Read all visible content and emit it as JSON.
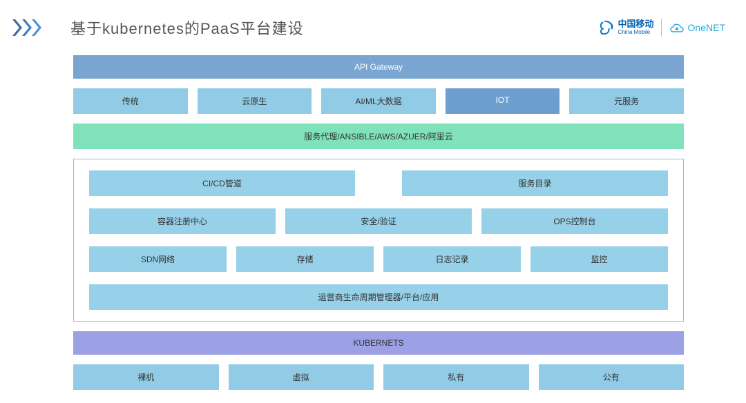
{
  "header": {
    "title": "基于kubernetes的PaaS平台建设",
    "logo1_main": "中国移动",
    "logo1_sub": "China Mobile",
    "logo2": "OneNET"
  },
  "rows": {
    "api": "API Gateway",
    "cats": [
      "传统",
      "云原生",
      "AI/ML大数据",
      "IOT",
      "元服务"
    ],
    "proxy": "服务代理/ANSIBLE/AWS/AZUER/阿里云",
    "mid_r1": [
      "CI/CD管道",
      "服务目录"
    ],
    "mid_r2": [
      "容器注册中心",
      "安全/验证",
      "OPS控制台"
    ],
    "mid_r3": [
      "SDN网络",
      "存储",
      "日志记录",
      "监控"
    ],
    "mid_r4": "运营商生命周期管理器/平台/应用",
    "kube": "KUBERNETS",
    "infra": [
      "裸机",
      "虚拟",
      "私有",
      "公有"
    ]
  }
}
